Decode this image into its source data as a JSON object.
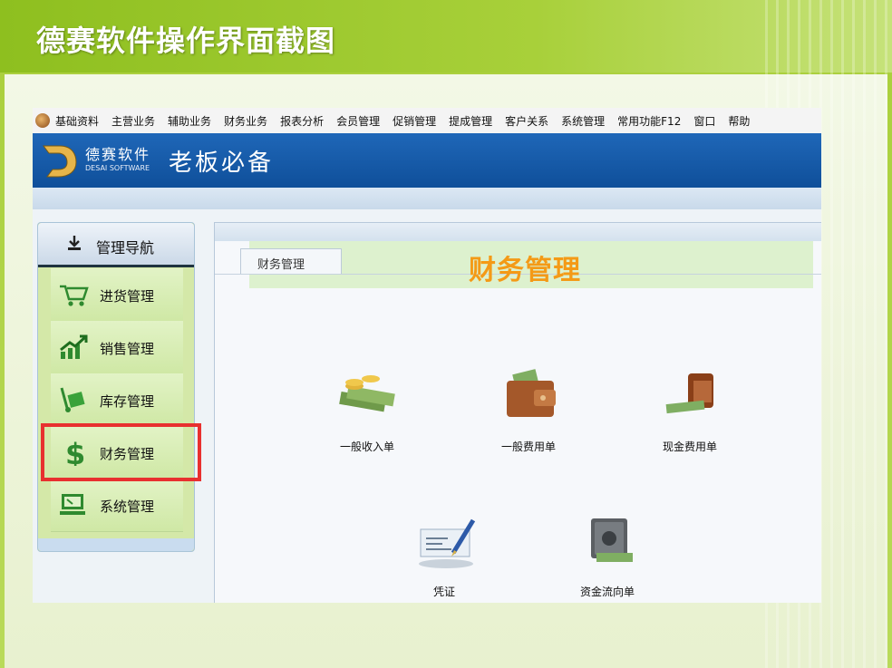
{
  "slide": {
    "title": "德赛软件操作界面截图"
  },
  "menubar": {
    "items": [
      "基础资料",
      "主营业务",
      "辅助业务",
      "财务业务",
      "报表分析",
      "会员管理",
      "促销管理",
      "提成管理",
      "客户关系",
      "系统管理",
      "常用功能F12",
      "窗口",
      "帮助"
    ]
  },
  "banner": {
    "logo_cn": "德赛软件",
    "logo_en": "DESAI SOFTWARE",
    "slogan": "老板必备"
  },
  "nav": {
    "header": "管理导航",
    "items": [
      {
        "label": "进货管理",
        "icon": "cart-icon"
      },
      {
        "label": "销售管理",
        "icon": "chart-up-icon"
      },
      {
        "label": "库存管理",
        "icon": "hand-truck-icon"
      },
      {
        "label": "财务管理",
        "icon": "dollar-icon"
      },
      {
        "label": "系统管理",
        "icon": "monitor-icon"
      }
    ],
    "selected": "财务管理"
  },
  "content": {
    "tab": "财务管理",
    "heading": "财务管理",
    "functions": [
      {
        "label": "一般收入单",
        "icon": "money-stack-icon"
      },
      {
        "label": "一般费用单",
        "icon": "wallet-icon"
      },
      {
        "label": "现金费用单",
        "icon": "cash-wallet-icon"
      },
      {
        "label": "凭证",
        "icon": "check-pen-icon"
      },
      {
        "label": "资金流向单",
        "icon": "safe-icon"
      }
    ]
  },
  "colors": {
    "slide_green": "#a9cf3a",
    "banner_blue": "#1f67b8",
    "heading_orange": "#f49a16",
    "highlight_red": "#e8302f"
  }
}
